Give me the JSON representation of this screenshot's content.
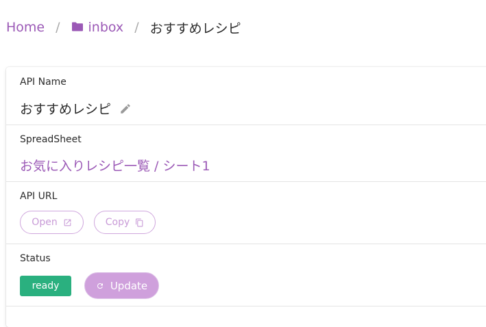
{
  "breadcrumb": {
    "home": "Home",
    "separator": "/",
    "folder": "inbox",
    "current": "おすすめレシピ"
  },
  "api_name": {
    "label": "API Name",
    "value": "おすすめレシピ"
  },
  "spreadsheet": {
    "label": "SpreadSheet",
    "value": "お気に入りレシピ一覧 / シート1"
  },
  "api_url": {
    "label": "API URL",
    "open_label": "Open",
    "copy_label": "Copy"
  },
  "status": {
    "label": "Status",
    "badge": "ready",
    "update_label": "Update"
  },
  "colors": {
    "accent": "#9b59b6",
    "ready": "#2ab07f",
    "update": "#cfa0dc"
  },
  "icons": [
    "folder-icon",
    "pencil-icon",
    "external-link-icon",
    "copy-icon",
    "refresh-icon"
  ]
}
